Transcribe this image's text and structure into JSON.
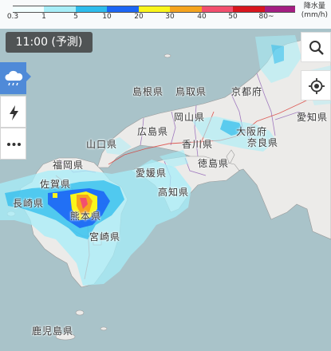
{
  "legend": {
    "title_line1": "降水量",
    "title_line2": "(mm/h)",
    "ticks": [
      {
        "label": "0.3"
      },
      {
        "label": "1"
      },
      {
        "label": "5"
      },
      {
        "label": "10"
      },
      {
        "label": "20"
      },
      {
        "label": "30"
      },
      {
        "label": "40"
      },
      {
        "label": "50"
      },
      {
        "label": "80~"
      }
    ],
    "colors": [
      "#f2ffff",
      "#a7eef8",
      "#2dbcec",
      "#1c66f5",
      "#faf51a",
      "#f5a41e",
      "#f24f6e",
      "#d8161e",
      "#a41e82"
    ]
  },
  "time_label": "11:00 (予測)",
  "side_buttons": [
    {
      "icon": "rain-cloud-icon"
    },
    {
      "icon": "lightning-icon"
    },
    {
      "icon": "more-icon"
    }
  ],
  "controls": [
    {
      "icon": "search-icon"
    },
    {
      "icon": "locate-icon"
    }
  ],
  "map_labels": [
    {
      "id": "shimane",
      "text": "島根県"
    },
    {
      "id": "tottori",
      "text": "鳥取県"
    },
    {
      "id": "kyoto",
      "text": "京都府"
    },
    {
      "id": "okayama",
      "text": "岡山県"
    },
    {
      "id": "hiroshima",
      "text": "広島県"
    },
    {
      "id": "osaka",
      "text": "大阪府"
    },
    {
      "id": "aichi",
      "text": "愛知県"
    },
    {
      "id": "kagawa",
      "text": "香川県"
    },
    {
      "id": "nara",
      "text": "奈良県"
    },
    {
      "id": "yamaguchi",
      "text": "山口県"
    },
    {
      "id": "tokushima",
      "text": "徳島県"
    },
    {
      "id": "fukuoka",
      "text": "福岡県"
    },
    {
      "id": "ehime",
      "text": "愛媛県"
    },
    {
      "id": "kochi",
      "text": "高知県"
    },
    {
      "id": "saga",
      "text": "佐賀県"
    },
    {
      "id": "nagasaki",
      "text": "長崎県"
    },
    {
      "id": "kumamoto",
      "text": "熊本県"
    },
    {
      "id": "miyazaki",
      "text": "宮崎県"
    },
    {
      "id": "kagoshima",
      "text": "鹿児島県"
    }
  ]
}
